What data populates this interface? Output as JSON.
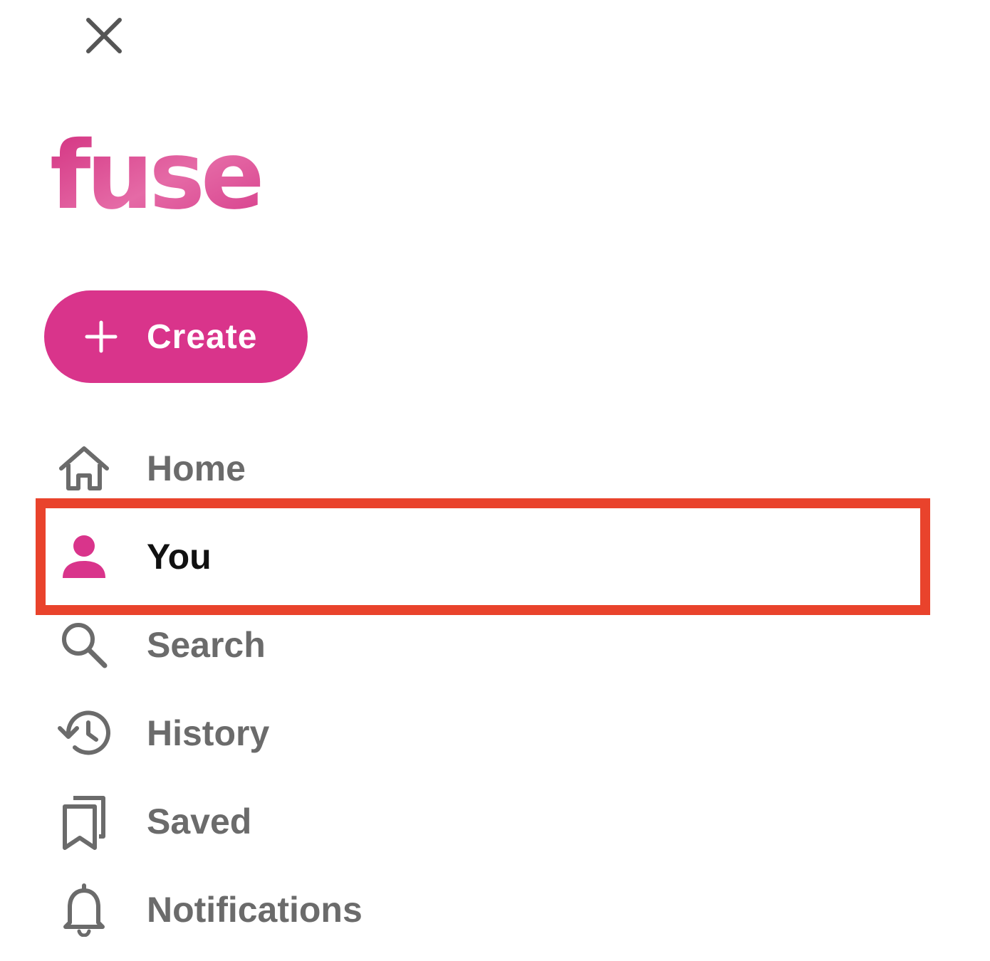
{
  "app": {
    "logo_text": "fuse",
    "brand_color": "#d9348b"
  },
  "header": {
    "close_icon": "close-icon"
  },
  "create_button": {
    "icon": "plus-icon",
    "label": "Create"
  },
  "nav": {
    "items": [
      {
        "icon": "home-icon",
        "label": "Home",
        "active": false
      },
      {
        "icon": "person-icon",
        "label": "You",
        "active": true
      },
      {
        "icon": "search-icon",
        "label": "Search",
        "active": false
      },
      {
        "icon": "history-icon",
        "label": "History",
        "active": false
      },
      {
        "icon": "bookmarks-icon",
        "label": "Saved",
        "active": false
      },
      {
        "icon": "bell-icon",
        "label": "Notifications",
        "active": false
      }
    ]
  },
  "annotation": {
    "highlight_color": "#e9432c",
    "highlighted_item": "You"
  }
}
